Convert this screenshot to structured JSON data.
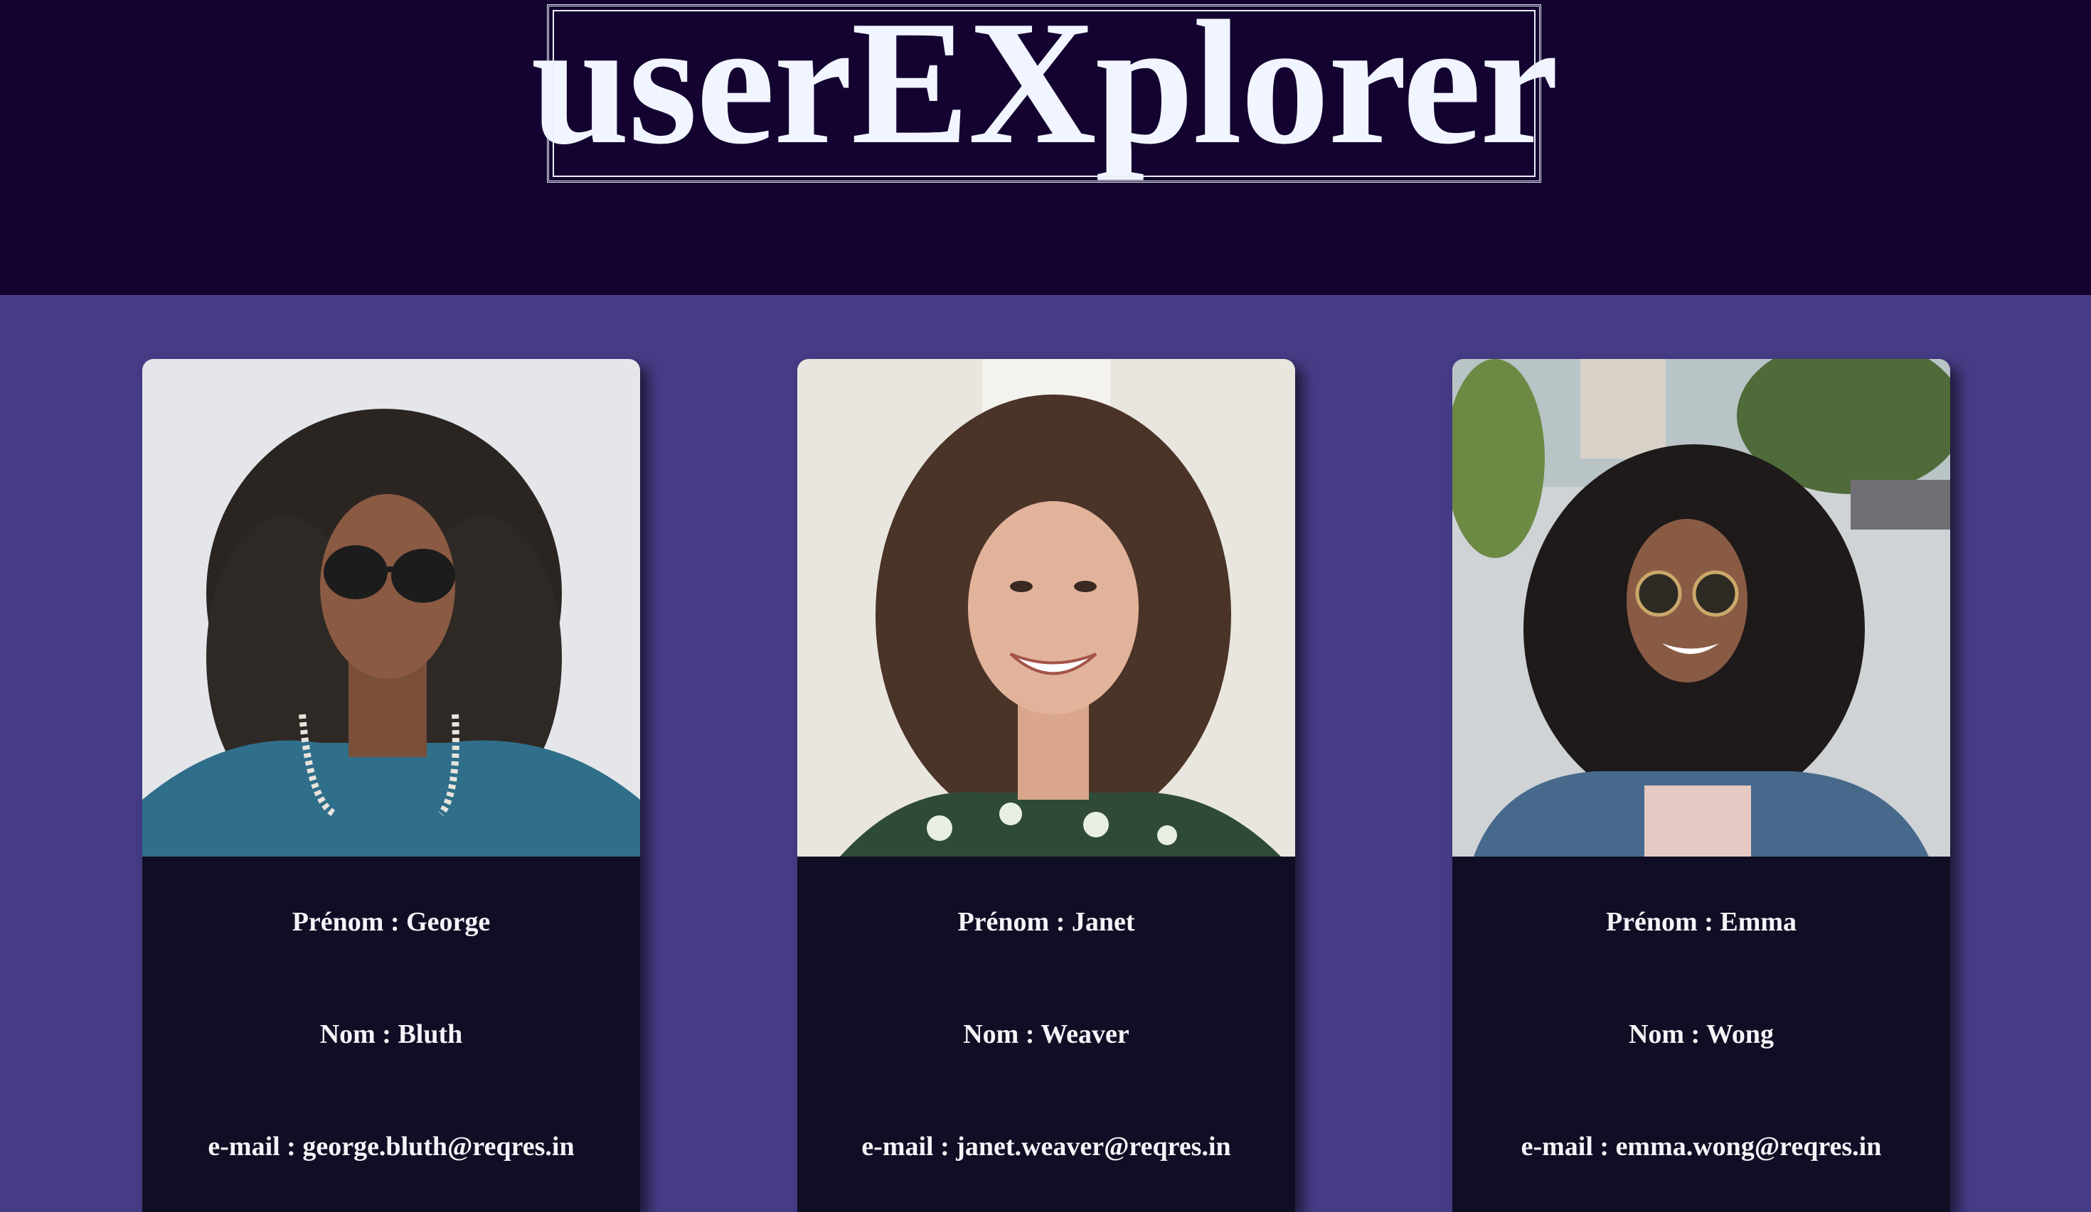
{
  "app": {
    "title": "userEXplorer"
  },
  "colors": {
    "header_bg": "#140330",
    "page_bg": "#463c86",
    "card_info_bg": "#100e24",
    "text": "#f4f4f8"
  },
  "users": [
    {
      "first_name_label": "Prénom : George",
      "last_name_label": "Nom : Bluth",
      "email_label": "e-mail : george.bluth@reqres.in",
      "avatar": "avatar-photo-george"
    },
    {
      "first_name_label": "Prénom : Janet",
      "last_name_label": "Nom : Weaver",
      "email_label": "e-mail : janet.weaver@reqres.in",
      "avatar": "avatar-photo-janet"
    },
    {
      "first_name_label": "Prénom : Emma",
      "last_name_label": "Nom : Wong",
      "email_label": "e-mail : emma.wong@reqres.in",
      "avatar": "avatar-photo-emma"
    }
  ]
}
